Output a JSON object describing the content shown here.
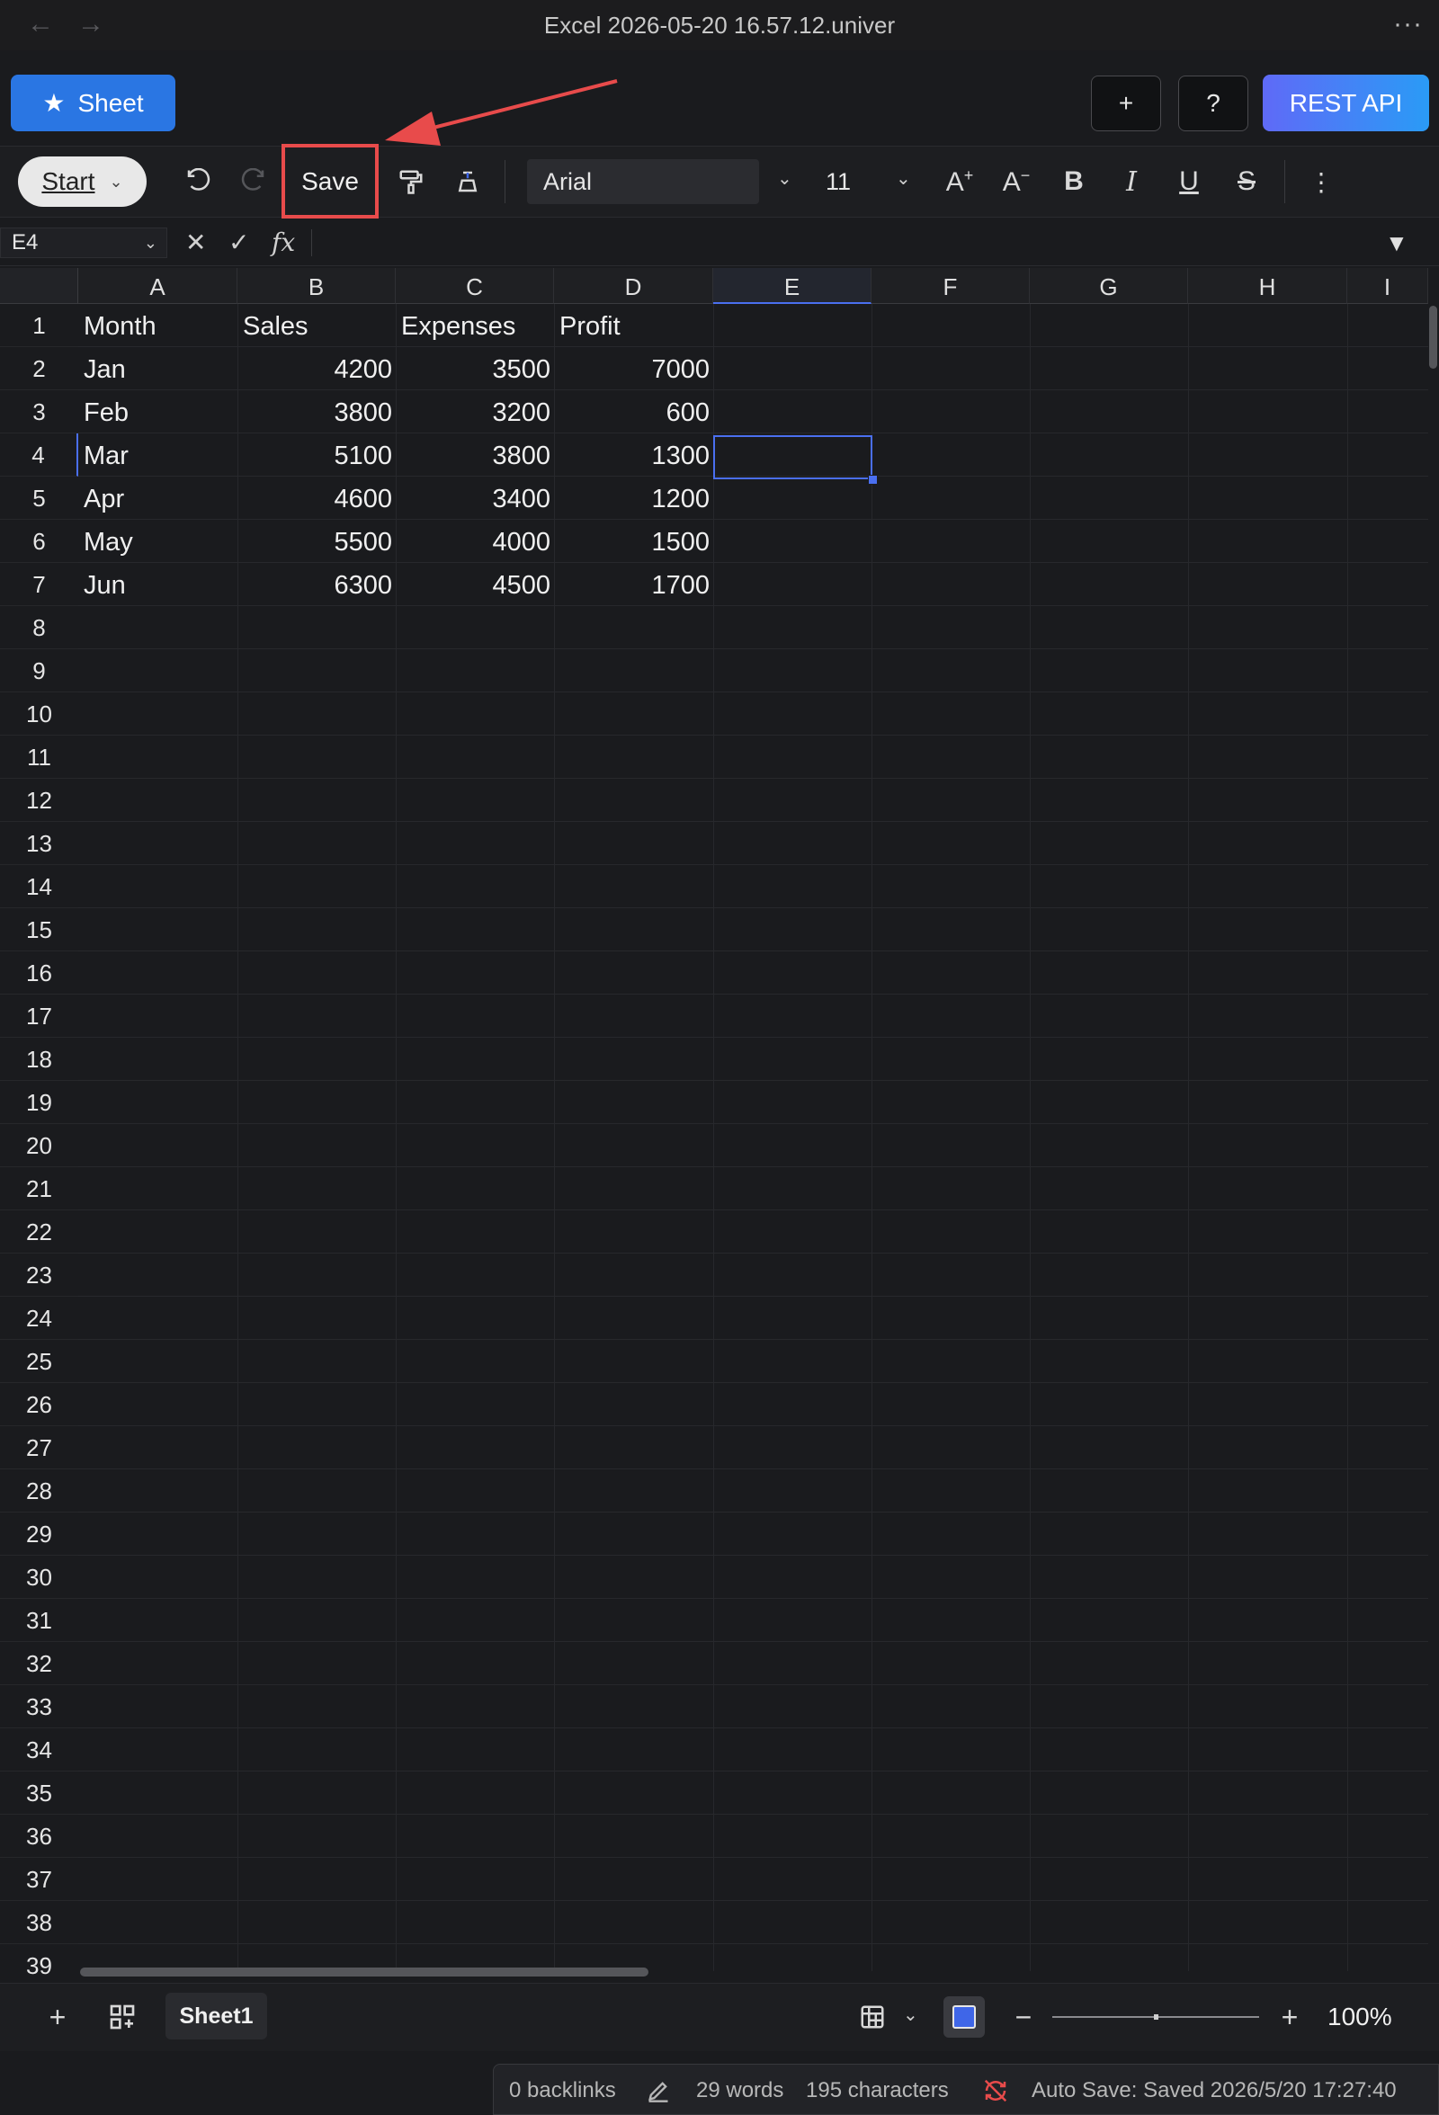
{
  "window": {
    "title": "Excel 2026-05-20 16.57.12.univer",
    "back_icon": "arrow-left-icon",
    "forward_icon": "arrow-right-icon",
    "more_icon": "more-horizontal-icon"
  },
  "header": {
    "sheet_button_label": "Sheet",
    "add_button_label": "+",
    "help_button_label": "?",
    "rest_api_label": "REST API"
  },
  "toolbar": {
    "start_label": "Start",
    "save_label": "Save",
    "font_name": "Arial",
    "font_size": "11",
    "icons": [
      "undo-icon",
      "redo-icon",
      "paint-format-icon",
      "clear-format-icon",
      "increase-font-icon",
      "decrease-font-icon",
      "bold-icon",
      "italic-icon",
      "underline-icon",
      "strikethrough-icon",
      "more-vertical-icon"
    ]
  },
  "formula_bar": {
    "cell_ref": "E4",
    "fx_label": "fx",
    "formula": ""
  },
  "grid": {
    "columns": [
      "A",
      "B",
      "C",
      "D",
      "E",
      "F",
      "G",
      "H",
      "I"
    ],
    "rows": [
      "1",
      "2",
      "3",
      "4",
      "5",
      "6",
      "7",
      "8",
      "9",
      "10",
      "11",
      "12",
      "13",
      "14",
      "15",
      "16",
      "17",
      "18",
      "19",
      "20",
      "21",
      "22",
      "23",
      "24",
      "25",
      "26",
      "27",
      "28",
      "29",
      "30",
      "31",
      "32",
      "33",
      "34",
      "35",
      "36",
      "37",
      "38",
      "39"
    ],
    "selected_cell": "E4",
    "headers": [
      "Month",
      "Sales",
      "Expenses",
      "Profit"
    ],
    "data": [
      [
        "Jan",
        "4200",
        "3500",
        "7000"
      ],
      [
        "Feb",
        "3800",
        "3200",
        "600"
      ],
      [
        "Mar",
        "5100",
        "3800",
        "1300"
      ],
      [
        "Apr",
        "4600",
        "3400",
        "1200"
      ],
      [
        "May",
        "5500",
        "4000",
        "1500"
      ],
      [
        "Jun",
        "6300",
        "4500",
        "1700"
      ]
    ]
  },
  "sheetbar": {
    "active_sheet": "Sheet1",
    "zoom": "100%",
    "zoom_level": 1.0
  },
  "status": {
    "backlinks": "0 backlinks",
    "words": "29 words",
    "characters": "195 characters",
    "autosave": "Auto Save: Saved 2026/5/20 17:27:40"
  },
  "colors": {
    "accent": "#2a76e3",
    "annotation": "#e84b4b",
    "selection": "#4a6ff0"
  }
}
